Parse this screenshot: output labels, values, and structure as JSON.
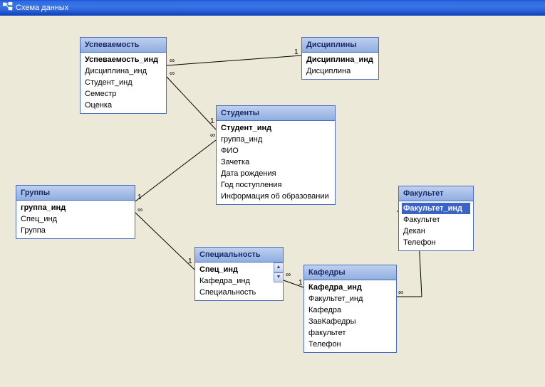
{
  "window": {
    "title": "Схема данных"
  },
  "tables": {
    "uspevaemost": {
      "title": "Успеваемость",
      "fields": [
        "Успеваемость_инд",
        "Дисциплина_инд",
        "Студент_инд",
        "Семестр",
        "Оценка"
      ],
      "pk_index": 0
    },
    "discipliny": {
      "title": "Дисциплины",
      "fields": [
        "Дисциплина_инд",
        "Дисциплина"
      ],
      "pk_index": 0
    },
    "studenty": {
      "title": "Студенты",
      "fields": [
        "Студент_инд",
        "группа_инд",
        "ФИО",
        "Зачетка",
        "Дата рождения",
        "Год поступления",
        "Информация об образовании"
      ],
      "pk_index": 0
    },
    "gruppy": {
      "title": "Группы",
      "fields": [
        "группа_инд",
        "Спец_инд",
        "Группа"
      ],
      "pk_index": 0
    },
    "specialnost": {
      "title": "Специальность",
      "fields": [
        "Спец_инд",
        "Кафедра_инд",
        "Специальность"
      ],
      "pk_index": 0
    },
    "kafedry": {
      "title": "Кафедры",
      "fields": [
        "Кафедра_инд",
        "Факультет_инд",
        "Кафедра",
        "ЗавКафедры",
        "факультет",
        "Телефон"
      ],
      "pk_index": 0
    },
    "fakultet": {
      "title": "Факультет",
      "fields": [
        "Факультет_инд",
        "Факультет",
        "Декан",
        "Телефон"
      ],
      "pk_index": 0,
      "selected_index": 0
    }
  },
  "cardinality": {
    "one": "1",
    "many": "∞"
  },
  "relationships": [
    {
      "from": "discipliny.Дисциплина_инд",
      "to": "uspevaemost.Дисциплина_инд",
      "type": "1:∞"
    },
    {
      "from": "studenty.Студент_инд",
      "to": "uspevaemost.Студент_инд",
      "type": "1:∞"
    },
    {
      "from": "gruppy.группа_инд",
      "to": "studenty.группа_инд",
      "type": "1:∞"
    },
    {
      "from": "specialnost.Спец_инд",
      "to": "gruppy.Спец_инд",
      "type": "1:∞"
    },
    {
      "from": "kafedry.Кафедра_инд",
      "to": "specialnost.Кафедра_инд",
      "type": "1:∞"
    },
    {
      "from": "fakultet.Факультет_инд",
      "to": "kafedry.Факультет_инд",
      "type": "1:∞"
    }
  ]
}
